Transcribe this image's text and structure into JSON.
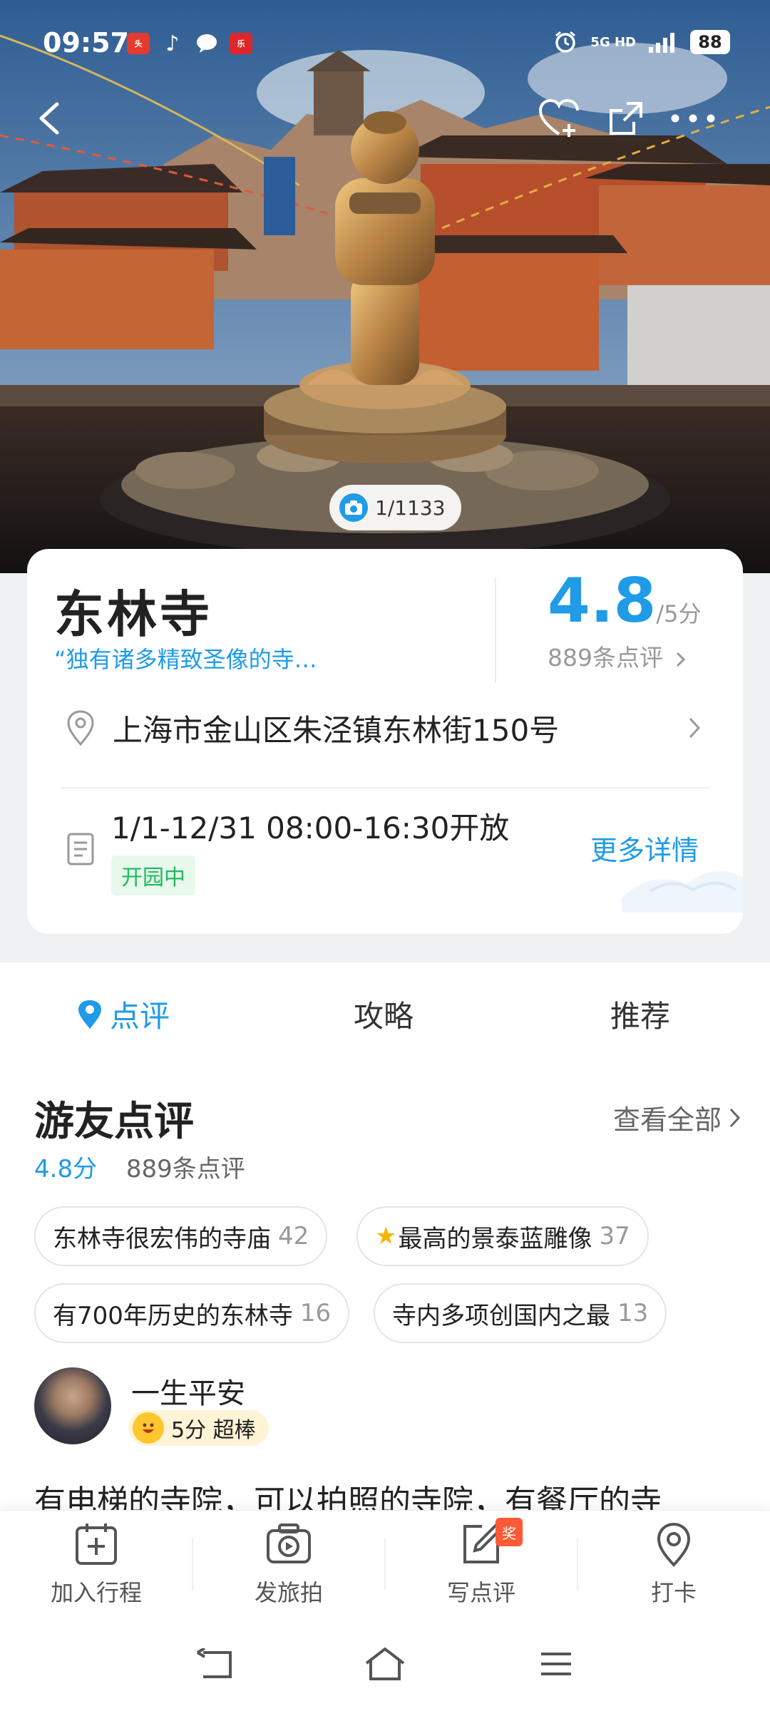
{
  "status": {
    "time": "09:57",
    "network": "5G HD",
    "battery": "88",
    "app_icons": [
      {
        "name": "toutiao-icon",
        "glyph": "头条",
        "color": "#e63a2e"
      },
      {
        "name": "tiktok-icon",
        "glyph": "♪",
        "color": "#111111"
      },
      {
        "name": "message-icon",
        "glyph": "●",
        "color": "#444444"
      },
      {
        "name": "app-icon",
        "glyph": "乐",
        "color": "#e0262a"
      }
    ]
  },
  "hero": {
    "photo_counter": "1/1133"
  },
  "poi": {
    "name": "东林寺",
    "tagline": "“独有诸多精致圣像的寺…",
    "score": "4.8",
    "score_max": "/5分",
    "review_count": "889条点评",
    "address": "上海市金山区朱泾镇东林街150号",
    "hours": "1/1-12/31 08:00-16:30开放",
    "status_badge": "开园中",
    "more_details": "更多详情"
  },
  "tabs": [
    {
      "label": "点评",
      "active": true
    },
    {
      "label": "攻略",
      "active": false
    },
    {
      "label": "推荐",
      "active": false
    }
  ],
  "reviews": {
    "title": "游友点评",
    "view_all": "查看全部",
    "score": "4.8分",
    "count": "889条点评",
    "chips": [
      {
        "text": "东林寺很宏伟的寺庙",
        "count": "42",
        "star": false
      },
      {
        "text": "最高的景泰蓝雕像",
        "count": "37",
        "star": true
      },
      {
        "text": "有700年历史的东林寺",
        "count": "16",
        "star": false
      },
      {
        "text": "寺内多项创国内之最",
        "count": "13",
        "star": false
      }
    ],
    "first": {
      "user": "一生平安",
      "rating": "5分 超棒",
      "snippet": "有电梯的寺院，可以拍照的寺院，有餐厅的寺"
    }
  },
  "actions": [
    {
      "label": "加入行程",
      "icon": "calendar-add-icon"
    },
    {
      "label": "发旅拍",
      "icon": "video-camera-icon"
    },
    {
      "label": "写点评",
      "icon": "edit-icon",
      "badge": "奖"
    },
    {
      "label": "打卡",
      "icon": "location-pin-icon"
    }
  ],
  "colors": {
    "accent": "#1f9be8",
    "open_green": "#1fba5b",
    "badge_red": "#ff5a36"
  }
}
